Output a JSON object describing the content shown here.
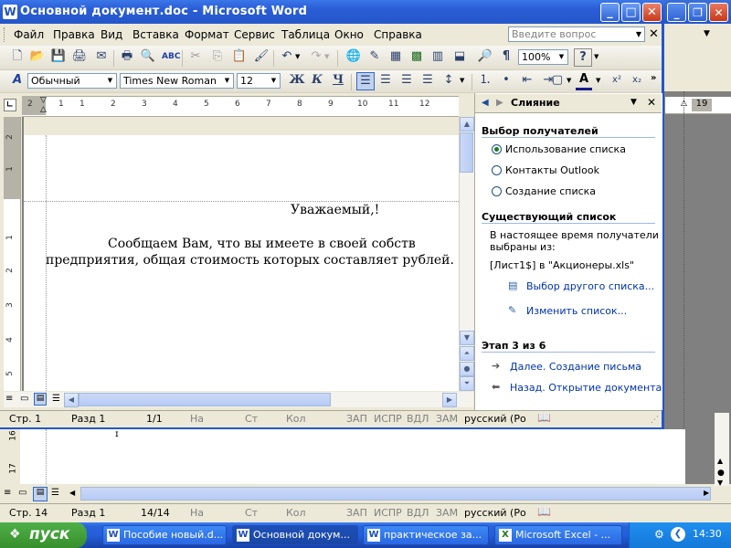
{
  "bg_window": {
    "status": {
      "page": "Стр.  14",
      "section": "Разд  1",
      "pages": "14/14",
      "at": "На",
      "line": "Ст",
      "col": "Кол",
      "rec": "ЗАП",
      "trk": "ИСПР",
      "ext": "ВДЛ",
      "ovr": "ЗАМ",
      "lang": "русский (Ро"
    },
    "ruler_num": "19"
  },
  "window": {
    "title": "Основной документ.doc - Microsoft Word",
    "controls": {
      "minimize": "_",
      "maximize": "□",
      "close": "✕"
    }
  },
  "menu": {
    "items": [
      "Файл",
      "Правка",
      "Вид",
      "Вставка",
      "Формат",
      "Сервис",
      "Таблица",
      "Окно",
      "Справка"
    ],
    "help_placeholder": "Введите вопрос",
    "close_glyph": "✕"
  },
  "toolbar": {
    "zoom": "100%",
    "style": "Обычный",
    "font": "Times New Roman",
    "size": "12",
    "bold": "Ж",
    "italic": "К",
    "underline": "Ч"
  },
  "ruler": {
    "numbers": [
      "2",
      "1",
      "1",
      "2",
      "3",
      "4",
      "5",
      "6",
      "7",
      "8",
      "9",
      "10",
      "11",
      "12"
    ],
    "vnumbers": [
      "2",
      "1",
      "1",
      "1",
      "2",
      "3",
      "4",
      "5"
    ]
  },
  "document": {
    "greeting": "Уважаемый,!",
    "para1": "Сообщаем  Вам,  что  вы  имеете  в  своей  собств",
    "para2": "предприятия, общая стоимость которых составляет рублей."
  },
  "status": {
    "page": "Стр.  1",
    "section": "Разд  1",
    "pages": "1/1",
    "at": "На",
    "line": "Ст",
    "col": "Кол",
    "rec": "ЗАП",
    "trk": "ИСПР",
    "ext": "ВДЛ",
    "ovr": "ЗАМ",
    "lang": "русский (Ро"
  },
  "task_pane": {
    "title": "Слияние",
    "section1": "Выбор получателей",
    "options": [
      {
        "label": "Использование списка",
        "selected": true
      },
      {
        "label": "Контакты Outlook",
        "selected": false
      },
      {
        "label": "Создание списка",
        "selected": false
      }
    ],
    "section2": "Существующий список",
    "desc_line1": "В настоящее время получатели",
    "desc_line2": "выбраны из:",
    "source": "[Лист1$] в \"Акционеры.xls\"",
    "link_select": "Выбор другого списка...",
    "link_edit": "Изменить список...",
    "step": "Этап 3 из 6",
    "next": "Далее. Создание письма",
    "back": "Назад. Открытие документа"
  },
  "taskbar": {
    "start": "пуск",
    "tasks": [
      {
        "label": "Пособие новый.d...",
        "active": false,
        "icon": "W"
      },
      {
        "label": "Основной докум...",
        "active": true,
        "icon": "W"
      },
      {
        "label": "практическое за...",
        "active": false,
        "icon": "W"
      },
      {
        "label": "Microsoft Excel - ...",
        "active": false,
        "icon": "X"
      }
    ],
    "lang": "RU",
    "clock": "14:30"
  }
}
